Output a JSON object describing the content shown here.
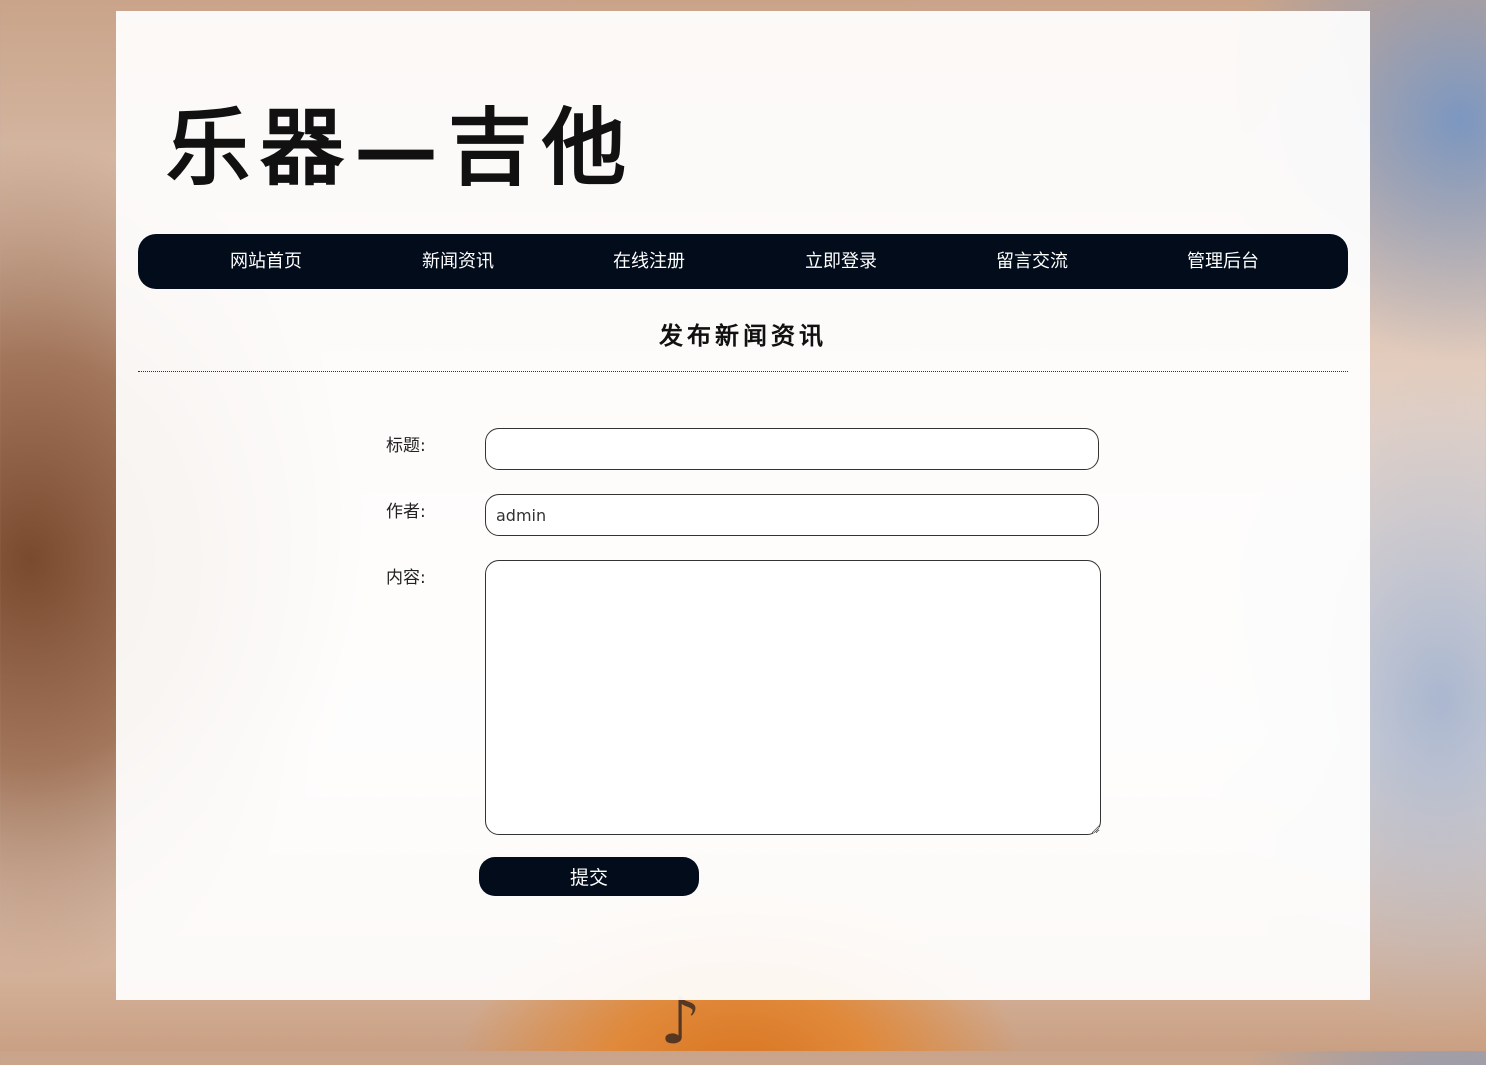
{
  "site": {
    "logo_text": "乐器—吉他"
  },
  "nav": {
    "items": [
      {
        "label": "网站首页"
      },
      {
        "label": "新闻资讯"
      },
      {
        "label": "在线注册"
      },
      {
        "label": "立即登录"
      },
      {
        "label": "留言交流"
      },
      {
        "label": "管理后台"
      }
    ]
  },
  "form": {
    "heading": "发布新闻资讯",
    "title_label": "标题:",
    "title_value": "",
    "author_label": "作者:",
    "author_value": "admin",
    "content_label": "内容:",
    "content_value": "",
    "submit_label": "提交"
  },
  "colors": {
    "nav_background": "#020c1b",
    "button_background": "#020c1b",
    "panel_background": "#ffffff"
  }
}
